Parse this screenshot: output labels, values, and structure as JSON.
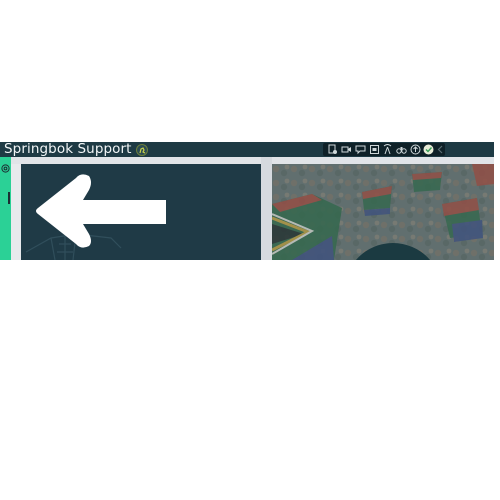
{
  "app": {
    "title": "Springbok Support",
    "title_badge_icon": "springbok-icon"
  },
  "toolbar": {
    "icons": [
      "document-settings-icon",
      "video-camera-icon",
      "chat-icon",
      "window-icon",
      "radio-tower-icon",
      "binoculars-icon",
      "upload-icon",
      "status-ok-icon",
      "chevron-left-icon"
    ]
  },
  "rail": {
    "icon": "settings-icon"
  },
  "tiles": {
    "left": {
      "icon": "arrow-left-icon",
      "background": "#1f3a46"
    },
    "right": {
      "image": "crowd-with-south-african-flags"
    }
  },
  "colors": {
    "titlebar": "#1e3a44",
    "accent": "#2bd196",
    "dark_tile": "#1f3a46"
  }
}
